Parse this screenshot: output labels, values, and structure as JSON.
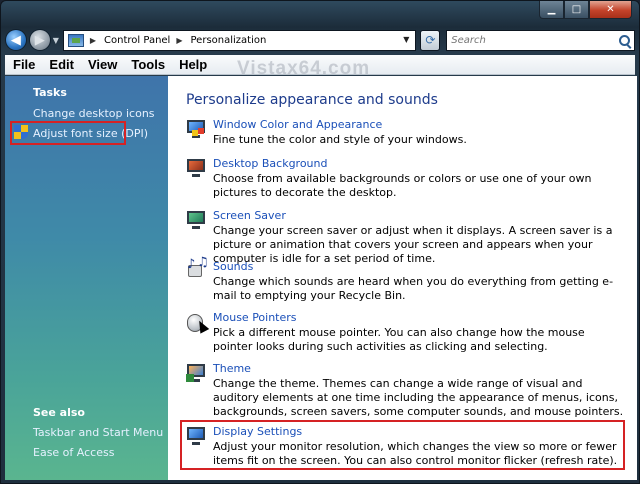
{
  "window": {
    "caption_buttons": {
      "minimize": "▁",
      "maximize": "□",
      "close": "✕"
    }
  },
  "address_bar": {
    "crumbs": [
      "Control Panel",
      "Personalization"
    ],
    "search_placeholder": "Search"
  },
  "watermark": "Vistax64.com",
  "menu": [
    "File",
    "Edit",
    "View",
    "Tools",
    "Help"
  ],
  "task_pane": {
    "tasks_heading": "Tasks",
    "tasks": [
      "Change desktop icons",
      "Adjust font size (DPI)"
    ],
    "see_also_heading": "See also",
    "see_also": [
      "Taskbar and Start Menu",
      "Ease of Access"
    ]
  },
  "content": {
    "title": "Personalize appearance and sounds",
    "items": [
      {
        "link": "Window Color and Appearance",
        "desc": "Fine tune the color and style of your windows.",
        "icon": "window-color-icon"
      },
      {
        "link": "Desktop Background",
        "desc": "Choose from available backgrounds or colors or use one of your own pictures to decorate the desktop.",
        "icon": "desktop-background-icon"
      },
      {
        "link": "Screen Saver",
        "desc": "Change your screen saver or adjust when it displays. A screen saver is a picture or animation that covers your screen and appears when your computer is idle for a set period of time.",
        "icon": "screen-saver-icon"
      },
      {
        "link": "Sounds",
        "desc": "Change which sounds are heard when you do everything from getting e-mail to emptying your Recycle Bin.",
        "icon": "sounds-icon"
      },
      {
        "link": "Mouse Pointers",
        "desc": "Pick a different mouse pointer. You can also change how the mouse pointer looks during such activities as clicking and selecting.",
        "icon": "mouse-icon"
      },
      {
        "link": "Theme",
        "desc": "Change the theme. Themes can change a wide range of visual and auditory elements at one time including the appearance of menus, icons, backgrounds, screen savers, some computer sounds, and mouse pointers.",
        "icon": "theme-icon"
      },
      {
        "link": "Display Settings",
        "desc": "Adjust your monitor resolution, which changes the view so more or fewer items fit on the screen. You can also control monitor flicker (refresh rate).",
        "icon": "display-icon"
      }
    ]
  },
  "colors": {
    "link": "#1a4fb8",
    "title": "#1e3c8c",
    "highlight": "#d52224"
  }
}
